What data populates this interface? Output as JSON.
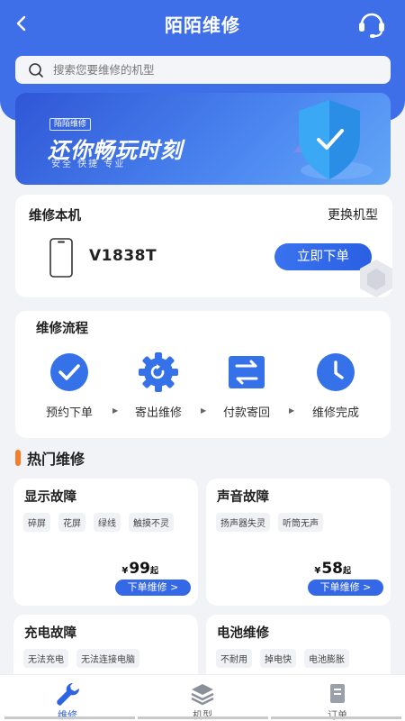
{
  "app": {
    "title": "陌陌维修"
  },
  "search": {
    "placeholder": "搜索您要维修的机型"
  },
  "banner": {
    "tag": "陌陌维修",
    "slogan": "还你畅玩时刻",
    "sub": "安全 快捷 专业"
  },
  "device": {
    "title": "维修本机",
    "change_label": "更换机型",
    "model": "V1838T",
    "order_label": "立即下单"
  },
  "flow": {
    "title": "维修流程",
    "steps": [
      {
        "label": "预约下单",
        "icon": "check-circle-icon"
      },
      {
        "label": "寄出维修",
        "icon": "gear-icon"
      },
      {
        "label": "付款寄回",
        "icon": "swap-icon"
      },
      {
        "label": "维修完成",
        "icon": "clock-icon"
      }
    ],
    "arrow": "▶"
  },
  "hot": {
    "title": "热门维修",
    "items": [
      {
        "title": "显示故障",
        "tags": [
          "碎屏",
          "花屏",
          "绿线",
          "触摸不灵"
        ],
        "price_symbol": "¥",
        "price": "99",
        "price_unit": "起",
        "button": "下单维修 >"
      },
      {
        "title": "声音故障",
        "tags": [
          "扬声器失灵",
          "听筒无声"
        ],
        "price_symbol": "¥",
        "price": "58",
        "price_unit": "起",
        "button": "下单维修 >"
      },
      {
        "title": "充电故障",
        "tags": [
          "无法充电",
          "无法连接电脑"
        ]
      },
      {
        "title": "电池维修",
        "tags": [
          "不耐用",
          "掉电快",
          "电池膨胀"
        ]
      }
    ]
  },
  "tabbar": {
    "items": [
      {
        "label": "维修"
      },
      {
        "label": "机型"
      },
      {
        "label": "订单"
      }
    ]
  },
  "colors": {
    "primary": "#3f6fe8",
    "accent_orange": "#f57d2c",
    "active_tab": "#2f63e6"
  }
}
